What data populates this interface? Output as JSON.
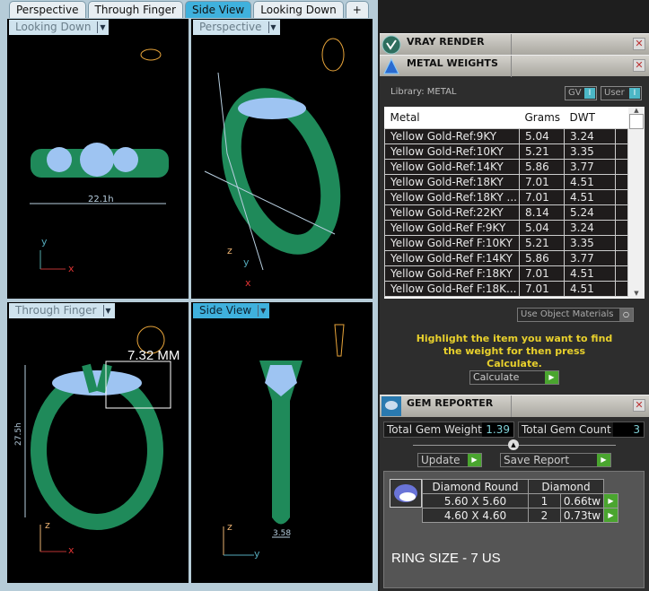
{
  "tabs": [
    "Perspective",
    "Through Finger",
    "Side View",
    "Looking Down",
    "+"
  ],
  "active_tab": "Side View",
  "viewports": {
    "top_left": {
      "label": "Looking Down",
      "dimension": "22.1h",
      "axes": [
        "y",
        "x"
      ]
    },
    "top_right": {
      "label": "Perspective",
      "axes": [
        "z",
        "y",
        "x"
      ]
    },
    "bottom_left": {
      "label": "Through Finger",
      "dimension": "27.5h",
      "annotation": "7.32 MM",
      "axes": [
        "z",
        "x"
      ]
    },
    "bottom_right": {
      "label": "Side View",
      "dimension": "3.58",
      "axes": [
        "z",
        "y"
      ]
    }
  },
  "panels": {
    "vray": {
      "title": "VRAY RENDER"
    },
    "metal": {
      "title": "METAL WEIGHTS",
      "library": "Library: METAL",
      "gv": "GV",
      "user": "User",
      "toggle_glyph": "I",
      "columns": [
        "Metal",
        "Grams",
        "DWT"
      ],
      "rows": [
        [
          "Yellow Gold-Ref:9KY",
          "5.04",
          "3.24"
        ],
        [
          "Yellow Gold-Ref:10KY",
          "5.21",
          "3.35"
        ],
        [
          "Yellow Gold-Ref:14KY",
          "5.86",
          "3.77"
        ],
        [
          "Yellow Gold-Ref:18KY",
          "7.01",
          "4.51"
        ],
        [
          "Yellow Gold-Ref:18KY ...",
          "7.01",
          "4.51"
        ],
        [
          "Yellow Gold-Ref:22KY",
          "8.14",
          "5.24"
        ],
        [
          "Yellow Gold-Ref F:9KY",
          "5.04",
          "3.24"
        ],
        [
          "Yellow Gold-Ref F:10KY",
          "5.21",
          "3.35"
        ],
        [
          "Yellow Gold-Ref F:14KY",
          "5.86",
          "3.77"
        ],
        [
          "Yellow Gold-Ref F:18KY",
          "7.01",
          "4.51"
        ],
        [
          "Yellow Gold-Ref F:18K...",
          "7.01",
          "4.51"
        ]
      ],
      "use_object_materials": "Use Object Materials",
      "hint": "Highlight the item you want to find the weight for then press Calculate.",
      "calculate": "Calculate"
    },
    "gem": {
      "title": "GEM REPORTER",
      "total_weight_label": "Total Gem Weight",
      "total_weight": "1.39",
      "total_count_label": "Total Gem Count",
      "total_count": "3",
      "update": "Update",
      "save_report": "Save Report",
      "shape": "Diamond Round",
      "type": "Diamond",
      "rows": [
        [
          "5.60 X 5.60",
          "1",
          "0.66tw"
        ],
        [
          "4.60 X 4.60",
          "2",
          "0.73tw"
        ]
      ],
      "ring_size": "RING SIZE - 7 US"
    }
  },
  "colors": {
    "metal": "#1f8a5a",
    "gem": "#9ec4f2",
    "accent": "#3fb1dd",
    "go": "#4aa52f",
    "hint": "#e8d02c"
  }
}
